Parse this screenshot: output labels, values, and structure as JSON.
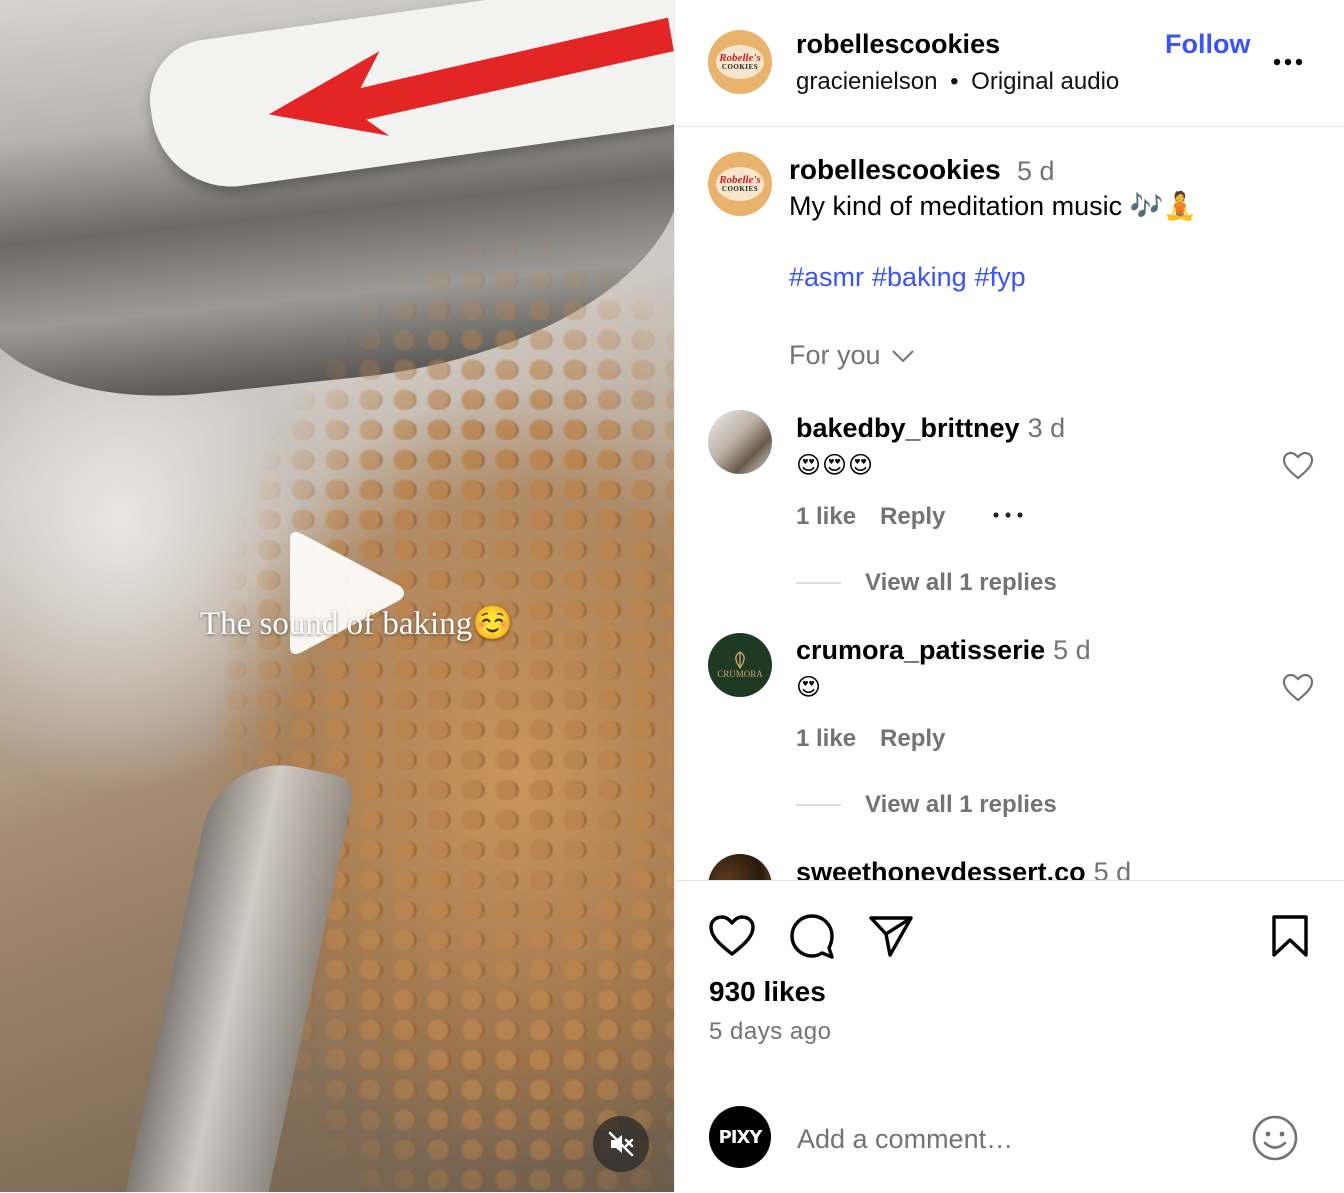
{
  "media": {
    "overlay_text": "The sound of baking",
    "overlay_emoji": "☺️",
    "play_icon": "play-icon",
    "mute_icon": "speaker-muted-icon"
  },
  "header": {
    "username": "robellescookies",
    "audio_user": "gracienielson",
    "separator": "•",
    "audio": "Original audio",
    "follow_label": "Follow",
    "avatar_text_top": "Robelle's",
    "avatar_text_bottom": "COOKIES"
  },
  "caption": {
    "username": "robellescookies",
    "time": "5 d",
    "text": "My kind of meditation music 🎶🧘",
    "hashtags": [
      "#asmr",
      "#baking",
      "#fyp"
    ]
  },
  "sort": {
    "label": "For you"
  },
  "comments": [
    {
      "username": "bakedby_brittney",
      "time": "3 d",
      "text": "😍😍😍",
      "likes": "1 like",
      "reply_label": "Reply",
      "view_replies": "View all 1 replies"
    },
    {
      "username": "crumora_patisserie",
      "time": "5 d",
      "text": "😍",
      "likes": "1 like",
      "reply_label": "Reply",
      "view_replies": "View all 1 replies",
      "avatar_text": "CRUMORA"
    },
    {
      "username": "sweethoneydessert.co",
      "time": "5 d"
    }
  ],
  "footer": {
    "likes": "930 likes",
    "posted": "5 days ago",
    "comment_placeholder": "Add a comment…",
    "avatar_text": "PIXY"
  },
  "colors": {
    "accent_link": "#3a55f0",
    "muted_text": "#737373",
    "divider": "#e3e3e3"
  }
}
